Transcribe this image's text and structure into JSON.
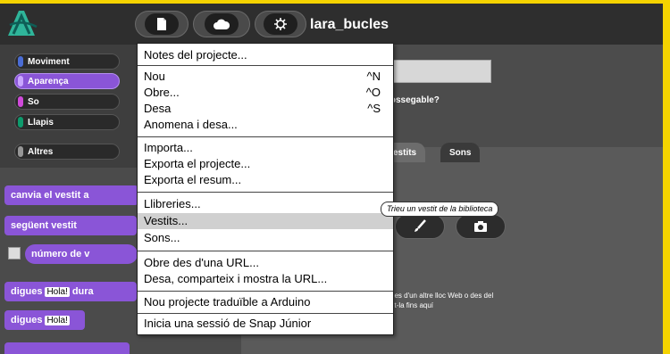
{
  "window": {
    "project_title": "lara_bucles"
  },
  "toolbar": {
    "file_icon": "file-icon",
    "cloud_icon": "cloud-icon",
    "settings_icon": "gear-icon"
  },
  "categories": [
    {
      "label": "Moviment",
      "color": "#4a6cd4"
    },
    {
      "label": "Aparença",
      "color": "#8a55d7"
    },
    {
      "label": "So",
      "color": "#cf4ad9"
    },
    {
      "label": "Llapis",
      "color": "#0e9a6c"
    },
    {
      "label": "Altres",
      "color": "#969696"
    }
  ],
  "palette_blocks": {
    "switch_costume": "canvia el vestit a",
    "next_costume": "següent vestit",
    "costume_number": "número de v",
    "say_for": "digues",
    "say_for_slot": "Hola!",
    "say_for_tail": "dura",
    "say": "digues",
    "say_slot": "Hola!"
  },
  "sprite": {
    "draggable_label": "rossegable?",
    "name_field_partial": "e"
  },
  "tabs": {
    "costumes": "estits",
    "sounds": "Sons"
  },
  "help_text": [
    "des d'un altre lloc Web o des del",
    "nt-la fins aquí"
  ],
  "menu": {
    "items": [
      {
        "label": "Notes del projecte...",
        "shortcut": ""
      },
      {
        "label": "Nou",
        "shortcut": "^N"
      },
      {
        "label": "Obre...",
        "shortcut": "^O"
      },
      {
        "label": "Desa",
        "shortcut": "^S"
      },
      {
        "label": "Anomena i desa...",
        "shortcut": ""
      },
      {
        "label": "Importa...",
        "shortcut": ""
      },
      {
        "label": "Exporta el projecte...",
        "shortcut": ""
      },
      {
        "label": "Exporta el resum...",
        "shortcut": ""
      },
      {
        "label": "Llibreries...",
        "shortcut": ""
      },
      {
        "label": "Vestits...",
        "shortcut": ""
      },
      {
        "label": "Sons...",
        "shortcut": ""
      },
      {
        "label": "Obre des d'una URL...",
        "shortcut": ""
      },
      {
        "label": "Desa, comparteix i mostra la URL...",
        "shortcut": ""
      },
      {
        "label": "Nou projecte traduïble a Arduino",
        "shortcut": ""
      },
      {
        "label": "Inicia una sessió de Snap Júnior",
        "shortcut": ""
      }
    ],
    "highlighted_index": 9
  },
  "tooltip": "Trieu un vestit de la biblioteca",
  "colors": {
    "looks": "#8a55d7",
    "frame": "#f5d300"
  }
}
